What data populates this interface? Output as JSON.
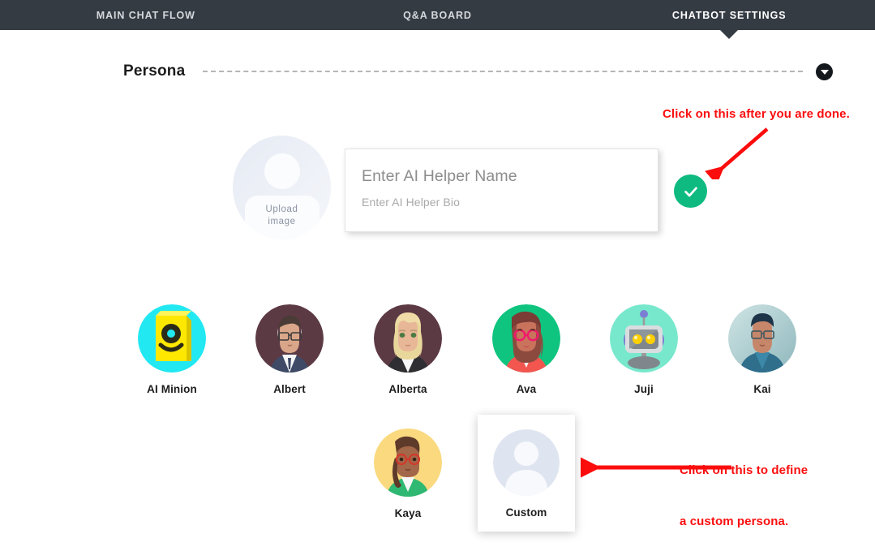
{
  "nav": {
    "tabs": [
      {
        "label": "MAIN CHAT FLOW",
        "active": false
      },
      {
        "label": "Q&A BOARD",
        "active": false
      },
      {
        "label": "CHATBOT SETTINGS",
        "active": true
      }
    ]
  },
  "section": {
    "title": "Persona",
    "collapse_icon": "chevron-down-icon"
  },
  "editor": {
    "upload": {
      "label_line1": "Upload",
      "label_line2": "image",
      "icon": "user-placeholder-icon"
    },
    "name_placeholder": "Enter AI Helper Name",
    "bio_placeholder": "Enter AI Helper Bio",
    "name_value": "",
    "bio_value": "",
    "confirm_icon": "check-icon",
    "confirm_color": "#0fba80"
  },
  "annotations": {
    "color": "#fb0d0d",
    "top_note": "Click on this after you are done.",
    "bottom_note_line1": "Click on this to define",
    "bottom_note_line2": "a custom persona.",
    "top_arrow": "diagonal-arrow-down-left",
    "bottom_arrow": "arrow-left"
  },
  "personas": {
    "row1": [
      {
        "name": "AI Minion",
        "avatar": "ai-minion-avatar",
        "selected": false
      },
      {
        "name": "Albert",
        "avatar": "albert-avatar",
        "selected": false
      },
      {
        "name": "Alberta",
        "avatar": "alberta-avatar",
        "selected": false
      },
      {
        "name": "Ava",
        "avatar": "ava-avatar",
        "selected": false
      },
      {
        "name": "Juji",
        "avatar": "juji-avatar",
        "selected": false
      },
      {
        "name": "Kai",
        "avatar": "kai-avatar",
        "selected": false
      }
    ],
    "row2": [
      {
        "name": "Kaya",
        "avatar": "kaya-avatar",
        "selected": false
      },
      {
        "name": "Custom",
        "avatar": "custom-placeholder-avatar",
        "selected": true
      }
    ]
  }
}
